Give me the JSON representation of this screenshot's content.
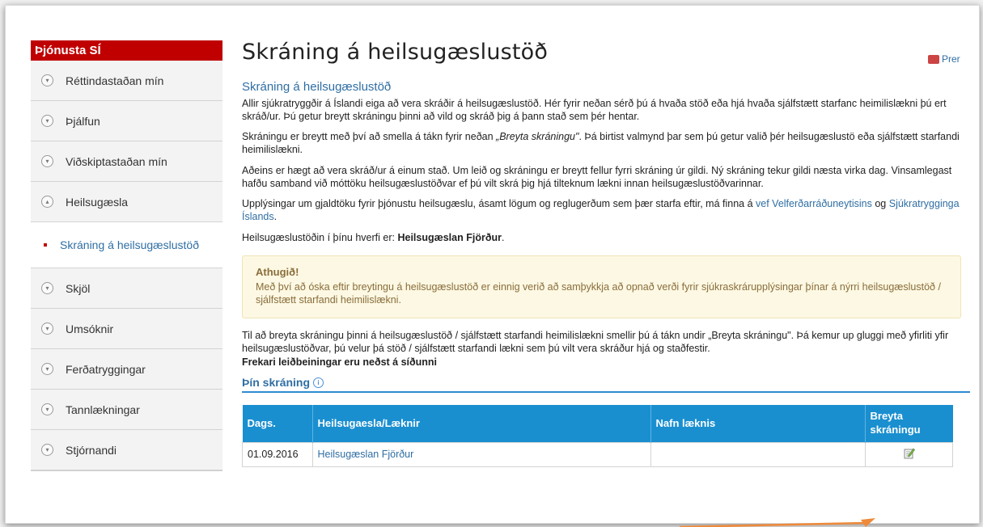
{
  "sidebar": {
    "header": "Þjónusta SÍ",
    "items": [
      {
        "label": "Réttindastaðan mín",
        "expanded": false
      },
      {
        "label": "Þjálfun",
        "expanded": false
      },
      {
        "label": "Viðskiptastaðan mín",
        "expanded": false
      },
      {
        "label": "Heilsugæsla",
        "expanded": true
      },
      {
        "label": "Skráning á heilsugæslustöð",
        "active": true
      },
      {
        "label": "Skjöl",
        "expanded": false
      },
      {
        "label": "Umsóknir",
        "expanded": false
      },
      {
        "label": "Ferðatryggingar",
        "expanded": false
      },
      {
        "label": "Tannlækningar",
        "expanded": false
      },
      {
        "label": "Stjórnandi",
        "expanded": false
      }
    ]
  },
  "main": {
    "title": "Skráning á heilsugæslustöð",
    "print_label": "Prer",
    "subtitle": "Skráning á heilsugæslustöð",
    "para1": "Allir sjúkratryggðir á Íslandi eiga að vera skráðir á heilsugæslustöð. Hér fyrir neðan sérð þú á hvaða stöð eða hjá hvaða sjálfstætt starfanc heimilislækni þú ert skráð/ur. Þú getur breytt skráningu þinni að vild og skráð þig á þann stað sem þér hentar.",
    "para2_a": "Skráningu er breytt með því að smella á tákn fyrir neðan ",
    "para2_em": "„Breyta skráningu\"",
    "para2_b": ". Þá birtist valmynd þar sem þú getur valið þér heilsugæslustö eða sjálfstætt starfandi heimilislækni.",
    "para3": "Aðeins er hægt að vera skráð/ur á einum stað. Um leið og skráningu er breytt fellur fyrri skráning úr gildi. Ný skráning tekur gildi næsta virka dag. Vinsamlegast hafðu samband við móttöku heilsugæslustöðvar ef þú vilt skrá þig hjá tilteknum lækni innan heilsugæslustöðvarinnar.",
    "para4_a": "Upplýsingar um gjaldtöku fyrir þjónustu heilsugæslu, ásamt lögum og reglugerðum sem þær starfa eftir, má finna á ",
    "para4_link1": "vef Velferðarráðuneytisins",
    "para4_mid": " og ",
    "para4_link2": "Sjúkratrygginga Íslands",
    "para4_end": ".",
    "para5_a": "Heilsugæslustöðin í þínu hverfi er: ",
    "para5_b": "Heilsugæslan Fjörður",
    "para5_end": ".",
    "warning_title": "Athugið!",
    "warning_text": "Með því að óska eftir breytingu á heilsugæslustöð er einnig verið að samþykkja að opnað verði fyrir sjúkraskrárupplýsingar þínar á nýrri heilsugæslustöð / sjálfstætt starfandi heimilislækni.",
    "para6": "Til að breyta skráningu þinni á heilsugæslustöð / sjálfstætt starfandi heimilislækni smellir þú á tákn undir „Breyta skráningu\". Þá kemur up gluggi með yfirliti yfir heilsugæslustöðvar, þú velur þá stöð / sjálfstætt starfandi lækni sem þú vilt vera skráður hjá og staðfestir.",
    "para6_bold": "Frekari leiðbeiningar eru neðst á síðunni",
    "section_title": "Þín skráning",
    "table": {
      "headers": [
        "Dags.",
        "Heilsugaesla/Læknir",
        "Nafn læknis",
        "Breyta skráningu"
      ],
      "row": {
        "date": "01.09.2016",
        "clinic": "Heilsugæslan Fjörður",
        "doctor": ""
      }
    }
  },
  "colors": {
    "accent_red": "#c00000",
    "link_blue": "#2f6ea3",
    "table_header": "#1a8fd0",
    "annotation_arrow": "#ee8a3a"
  }
}
